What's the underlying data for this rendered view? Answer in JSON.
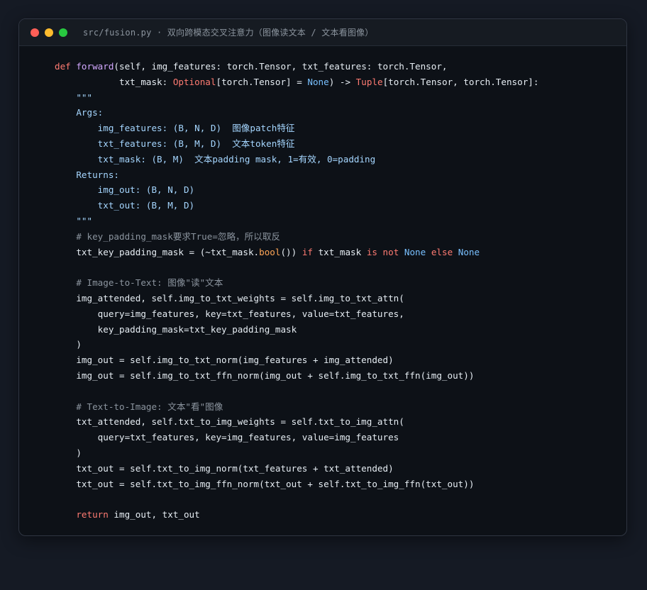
{
  "window": {
    "title": "src/fusion.py · 双向跨模态交叉注意力（图像读文本 / 文本看图像）",
    "colors": {
      "background": "#151a24",
      "editor": "#0d1117",
      "titlebar": "#161b22",
      "close": "#ff5f57",
      "minimize": "#febc2e",
      "maximize": "#28c840"
    }
  },
  "code": {
    "language": "python",
    "lines": [
      [
        [
          "kw",
          "def "
        ],
        [
          "fn",
          "forward"
        ],
        [
          "plain",
          "(self, img_features: torch.Tensor, txt_features: torch.Tensor,"
        ]
      ],
      [
        [
          "plain",
          "            txt_mask: "
        ],
        [
          "type",
          "Optional"
        ],
        [
          "plain",
          "[torch.Tensor] = "
        ],
        [
          "const",
          "None"
        ],
        [
          "plain",
          ") -> "
        ],
        [
          "type",
          "Tuple"
        ],
        [
          "plain",
          "[torch.Tensor, torch.Tensor]:"
        ]
      ],
      [
        [
          "doc",
          "    \"\"\""
        ]
      ],
      [
        [
          "doc",
          "    Args:"
        ]
      ],
      [
        [
          "doc",
          "        img_features: (B, N, D)  图像patch特征"
        ]
      ],
      [
        [
          "doc",
          "        txt_features: (B, M, D)  文本token特征"
        ]
      ],
      [
        [
          "doc",
          "        txt_mask: (B, M)  文本padding mask, 1=有效, 0=padding"
        ]
      ],
      [
        [
          "doc",
          "    Returns:"
        ]
      ],
      [
        [
          "doc",
          "        img_out: (B, N, D)"
        ]
      ],
      [
        [
          "doc",
          "        txt_out: (B, M, D)"
        ]
      ],
      [
        [
          "doc",
          "    \"\"\""
        ]
      ],
      [
        [
          "cmt",
          "    # key_padding_mask要求True=忽略，所以取反"
        ]
      ],
      [
        [
          "plain",
          "    txt_key_padding_mask = (~txt_mask."
        ],
        [
          "bi",
          "bool"
        ],
        [
          "plain",
          "()) "
        ],
        [
          "kw",
          "if"
        ],
        [
          "plain",
          " txt_mask "
        ],
        [
          "kw",
          "is not "
        ],
        [
          "const",
          "None"
        ],
        [
          "kw",
          " else "
        ],
        [
          "const",
          "None"
        ]
      ],
      [],
      [
        [
          "cmt",
          "    # Image-to-Text: 图像\"读\"文本"
        ]
      ],
      [
        [
          "plain",
          "    img_attended, self.img_to_txt_weights = self.img_to_txt_attn("
        ]
      ],
      [
        [
          "plain",
          "        query=img_features, key=txt_features, value=txt_features,"
        ]
      ],
      [
        [
          "plain",
          "        key_padding_mask=txt_key_padding_mask"
        ]
      ],
      [
        [
          "plain",
          "    )"
        ]
      ],
      [
        [
          "plain",
          "    img_out = self.img_to_txt_norm(img_features + img_attended)"
        ]
      ],
      [
        [
          "plain",
          "    img_out = self.img_to_txt_ffn_norm(img_out + self.img_to_txt_ffn(img_out))"
        ]
      ],
      [],
      [
        [
          "cmt",
          "    # Text-to-Image: 文本\"看\"图像"
        ]
      ],
      [
        [
          "plain",
          "    txt_attended, self.txt_to_img_weights = self.txt_to_img_attn("
        ]
      ],
      [
        [
          "plain",
          "        query=txt_features, key=img_features, value=img_features"
        ]
      ],
      [
        [
          "plain",
          "    )"
        ]
      ],
      [
        [
          "plain",
          "    txt_out = self.txt_to_img_norm(txt_features + txt_attended)"
        ]
      ],
      [
        [
          "plain",
          "    txt_out = self.txt_to_img_ffn_norm(txt_out + self.txt_to_img_ffn(txt_out))"
        ]
      ],
      [],
      [
        [
          "kw",
          "    return"
        ],
        [
          "plain",
          " img_out, txt_out"
        ]
      ]
    ]
  }
}
